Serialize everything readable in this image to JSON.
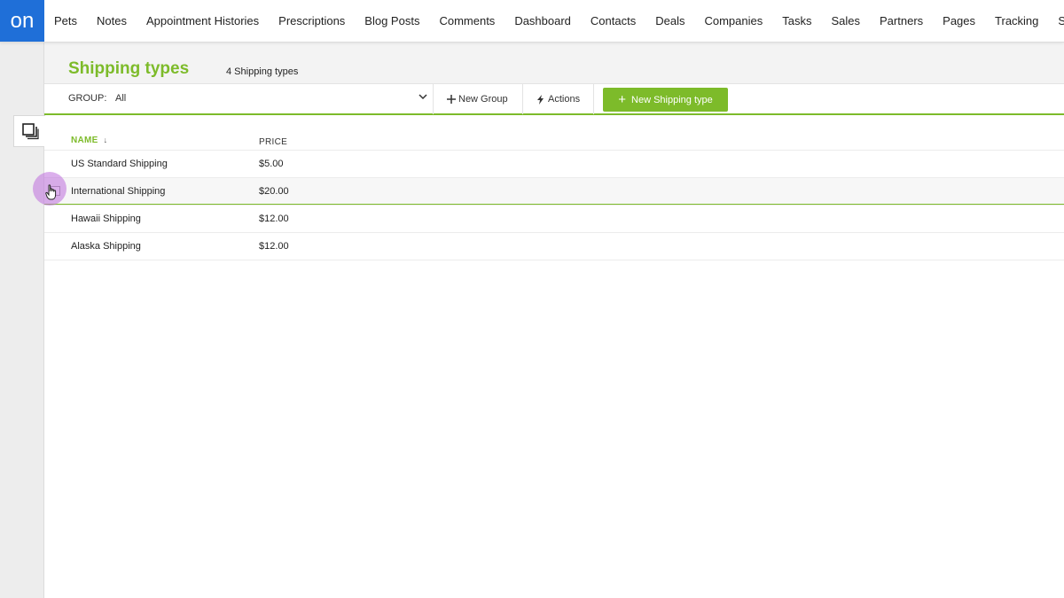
{
  "app": {
    "logo_text": "on",
    "brand_color": "#1f6fd8",
    "accent_color": "#7dbb2a"
  },
  "nav": {
    "items": [
      "Pets",
      "Notes",
      "Appointment Histories",
      "Prescriptions",
      "Blog Posts",
      "Comments",
      "Dashboard",
      "Contacts",
      "Deals",
      "Companies",
      "Tasks",
      "Sales",
      "Partners",
      "Pages",
      "Tracking",
      "Systems"
    ]
  },
  "sidebar": {
    "collection_icon": "stacked-pages-icon"
  },
  "page": {
    "title": "Shipping types",
    "count_text": "4 Shipping types"
  },
  "toolbar": {
    "group_label": "GROUP:",
    "group_value": "All",
    "new_group_label": "New Group",
    "actions_label": "Actions",
    "new_record_label": "New Shipping type"
  },
  "table": {
    "columns": {
      "name": "NAME",
      "price": "PRICE"
    },
    "sort": "name-descending",
    "rows": [
      {
        "name": "US Standard Shipping",
        "price": "$5.00"
      },
      {
        "name": "International Shipping",
        "price": "$20.00"
      },
      {
        "name": "Hawaii Shipping",
        "price": "$12.00"
      },
      {
        "name": "Alaska Shipping",
        "price": "$12.00"
      }
    ]
  }
}
